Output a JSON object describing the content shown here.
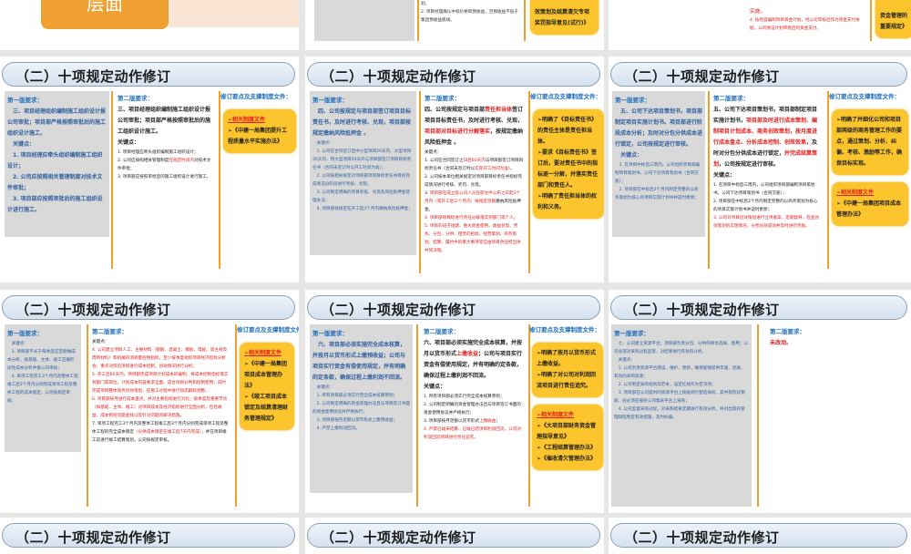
{
  "top": {
    "left_tag": "层面",
    "middle": {
      "lines": [
        "划。",
        "2. 项目经理确认中标价格和预收益，且预收益不低于集团预收益底线。"
      ],
      "box": "效策划及结算清欠专项奖罚指导意见(试行)》"
    },
    "right": {
      "lines": [
        "实施。",
        "4. 按月度编制项目资金计划，经公司审核后作为资金支付依据，公司保证计划审批后的资金支付。"
      ],
      "box": "资金管理的重要规定》"
    }
  },
  "slides": [
    {
      "title": "（二）十项规定动作修订",
      "v1": {
        "heading": "第一版要求：",
        "paras": [
          [
            "三、项目经理组织编制施工组织设计报公司审批；项目部严格按照审批后的施工组织设计施工。"
          ],
          [
            "关键点："
          ],
          [
            "1. 项目经理应牵头组织编制施工组织设计；"
          ],
          [
            "2. 公司应按照相关管理制度对技术文件审批；"
          ],
          [
            "3. 项目部应按照审批后的施工组织设计进行施工。"
          ]
        ]
      },
      "v2": {
        "heading": "第二版要求：",
        "paras": [
          {
            "segs": [
              [
                "三、项目经理组织编制施工组织设计报公司审批；项目部严格按照审批后的施工组织设计施工。",
                0
              ]
            ]
          },
          {
            "segs": [
              [
                "关键点：",
                0
              ]
            ]
          },
          {
            "small": 1,
            "segs": [
              [
                "1. 项目经理应牵头组织编制施工组织设计；",
                0
              ]
            ]
          },
          {
            "small": 1,
            "segs": [
              [
                "2. 公司应按照相关管理制度",
                0
              ],
              [
                "在规定时间内",
                1
              ],
              [
                "对技术文件审批；",
                0
              ]
            ]
          },
          {
            "small": 1,
            "segs": [
              [
                "3. 项目部应按照审批后的施工组织设计进行施工。",
                0
              ]
            ]
          }
        ]
      },
      "right": {
        "heading": "修订要点及支撑制度文件：",
        "boxes": [
          [
            "#➢相关制度文件",
            "➢《中建一局集团提升工程质量水平实施办法》"
          ]
        ]
      }
    },
    {
      "title": "（二）十项规定动作修订",
      "v1": {
        "heading": "第一版要求：",
        "paras": [
          [
            "四、公司按规定与项目部签订项目目标责任书，及时进行考核、兑现，项目部按规定缴纳风险抵押金 。"
          ],
          [
            "关键点：",
            1
          ],
          [
            "1. 公司在合同签订后中小型项目20天内、大型项目35天内、特大型项目50天内与项目部签订项目目标责任书（合同未签订时以开工时间为准）；",
            1
          ],
          [
            "2. 公司按相关规定对项目部项目目标责任书目标完成情况分阶段进行考核、兑现。",
            1
          ],
          [
            "3. 公司制定明确的项目考核、兑现及风险抵押金管理办法；",
            1
          ],
          [
            "4. 项目部按规定在开工后3个月内缴纳风险抵押金；",
            1
          ]
        ]
      },
      "v2": {
        "heading": "第二版要求：",
        "paras": [
          {
            "segs": [
              [
                "四、公司按规定与项目部",
                0
              ],
              [
                "责任担当体",
                1
              ],
              [
                "签订项目目标责任书，及时进行考核、兑现，",
                0
              ],
              [
                "项目部对目标进行分解落实",
                1
              ],
              [
                "，按规定缴纳风险抵押金 。",
                0
              ]
            ]
          },
          {
            "small": 1,
            "segs": [
              [
                "关键点：",
                0
              ]
            ]
          },
          {
            "small": 1,
            "segs": [
              [
                "1. 公司在合同签订之",
                0
              ],
              [
                "日后60天内",
                1
              ],
              [
                "与项目部签订项目目标责任书（合同未签订时以",
                0
              ],
              [
                "实际开工时间为准",
                1
              ],
              [
                "）。",
                0
              ]
            ]
          },
          {
            "small": 1,
            "segs": [
              [
                "2. 公司按本单位相关规定对项目部目标责任书指标完成情况进行考核、奖罚、兑现。",
                0
              ]
            ]
          },
          {
            "small": 1,
            "segs": [
              [
                "3. ",
                0
              ],
              [
                "项目部在成立及公司人员任职文件公布之日起2个月内（或开工后三个月内）按规定足额",
                1
              ],
              [
                "缴纳风险抵押金。",
                0
              ]
            ]
          },
          {
            "small": 1,
            "segs": [
              [
                "4. 项目部将目标进行责任分解落实到部门或个人。",
                1
              ]
            ]
          },
          {
            "small": 1,
            "segs": [
              [
                "5. 项目的班子组建、重大资金使用、收益兑现、劳务、分包、分供、租赁的招标、经营策划、商务策划、结算、履约中的重大事项等应由项目责任担当体共同决策。",
                1
              ]
            ]
          }
        ]
      },
      "right": {
        "heading": "修订要点及支撑制度文件：",
        "boxes": [
          [
            "➢明确了《目标责任书》的责任主体是责任担当体。",
            "➢要求《目标责任书》签订后，要对责任书中的指标逐一分解，并落实责任部门和责任人。",
            "➢明确了责任担当体的权利和义务。"
          ]
        ]
      }
    },
    {
      "title": "（二）十项规定动作修订",
      "v1": {
        "heading": "第一版要求：",
        "paras": [
          [
            "五、公司下达项目策划书，项目部制定项目实施计划书。项目部进行阶段成本分析；及时对分包分供成本进行锁定，公司按规定进行审核。"
          ],
          [
            "关键点："
          ],
          [
            "1. 在项目中标后三周内，公司组织项目部编制项目策划书，公司下达项目策划书（合同交底）；",
            1
          ],
          [
            "2. 项目部在中标后2个月内制定完整的以商务策划为核心的项目实施计划书并适时更新；",
            1
          ]
        ]
      },
      "v2": {
        "heading": "第二版要求：",
        "paras": [
          {
            "segs": [
              [
                "五、公司下达项目策划书，项目部制定项目实施计划书，",
                0
              ],
              [
                "项目部及时进行成本策划、编制项目计划成本、商务创效策划，按月度进行成本盘点、分析成本控制、创效效果",
                1
              ],
              [
                "，及时对分包分供成本进行锁定，",
                0
              ],
              [
                "并完成结算策划",
                1
              ],
              [
                "，公司按规定进行审核。",
                0
              ]
            ]
          },
          {
            "segs": [
              [
                "关键点：",
                0
              ]
            ]
          },
          {
            "small": 1,
            "segs": [
              [
                "1. 在项目中标后三周内，公司组织项目部编制项目策划书，公司下达项目策划书（合同交底）；",
                0
              ]
            ]
          },
          {
            "small": 1,
            "segs": [
              [
                "2. 项目部在中标后2个月内制定完整的以商务策划为核心的项目实施计划书并适时更新；",
                0
              ]
            ]
          },
          {
            "small": 1,
            "segs": [
              [
                "3. 公司对项目创效策划进行立项备案，定期督导，检查创效策划的实施情况，分析创效成效并及时进行奖励。",
                1
              ]
            ]
          }
        ]
      },
      "right": {
        "heading": "修订要点及支撑制度文件：",
        "boxes": [
          [
            "➢明确了并细化公司和项目部两级的商务管理工作的要点，通过策划、分析、纠偏、考核、激励等工作，确保目标实现。"
          ],
          [
            "#➢相关制度文件",
            "➢《中建一局集团项目成本管理办法》"
          ]
        ]
      }
    },
    {
      "title": "（二）十项规定动作修订",
      "v1": {
        "heading": "第一版要求：",
        "paras": [
          [
            "关键点：",
            1
          ],
          [
            "3. 项目部不长于每季度应定期做成本分析，按基础、主体、竣工应做阶段性成本分析并报公司审核；",
            1
          ],
          [
            "4. 单项工程完工3个月内及整体工程竣工后3个月内分别完成单项工程及整体工程的成本锁定，公司按规定审核；",
            1
          ]
        ]
      },
      "v2": {
        "heading": "第二版要求：",
        "paras": [
          {
            "small": 1,
            "segs": [
              [
                "关键点：",
                0
              ]
            ]
          },
          {
            "small": 1,
            "segs": [
              [
                "4. 公司建立项目人工、主要材料（钢筋、混凝土、模板、电缆、等主材及周转材料）和机械的消耗量控制指标，至少按季度组织项目经济指标分析会，重点对风险项目进行成本控制，创效情况进行分析。",
                1
              ]
            ]
          },
          {
            "small": 1,
            "segs": [
              [
                "5. 开工后60天内，项目部完成项目计划成本的编制，将成本控制指标落实到部门或岗位。计划成本内容要求全面，适合项目分判和控制使用；同时完成项目整体商务创效策划，在施工过程中进行动态跟踪调整。",
                1
              ]
            ]
          },
          {
            "small": 1,
            "segs": [
              [
                "6. 项目部按月进行成本盘点，并对主要指标进行对比；按季度及重要节点（如基础、主体、竣工）对项目成本及经济指标进行全面分析，包括收益、成本管控问题查找以及针对问题的解决措施。",
                1
              ]
            ]
          },
          {
            "small": 1,
            "segs": [
              [
                "7. 单项工程完工3个月内及整体工程竣工后3个月内分别完成单项工程及整体工程的完全成本锁定",
                0
              ],
              [
                "（分供成本锁定在竣工后7天内完成）",
                1
              ],
              [
                "，并在项目竣工前进行竣工结算策划，公司按规定审核。",
                0
              ]
            ]
          }
        ]
      },
      "right": {
        "heading": "修订要点及支撑制度文件：",
        "boxes": [
          [
            "#➢相关制度文件",
            "➢《中建一局集团项目成本管理办法》",
            "➢《竣工项目成本锁定及结算清理财务管理规定》"
          ]
        ]
      }
    },
    {
      "title": "（二）十项规定动作修订",
      "v1": {
        "heading": "第一版要求：",
        "paras": [
          [
            "六、项目部必须实施完全成本核算，并按月以货币形式上缴预收益；公司与项目实行资金有偿使用规定，并有明确的定条款，确保过程上缴利润不回流。"
          ],
          [
            "关键点：",
            1
          ],
          [
            "1. 所有项目部必须实行完全成本核算原则；",
            1
          ],
          [
            "2. 公司制定明确的资金管理办法且与项目签订书面的资金使用协议并严格执行；",
            1
          ],
          [
            "3. 项目部按月足额以货币形式上缴预收益；",
            1
          ],
          [
            "4. 严禁上缴利润回流。",
            1
          ]
        ]
      },
      "v2": {
        "heading": "第二版要求：",
        "paras": [
          {
            "segs": [
              [
                "六、项目部必须实施完全成本核算，并按月以货币形式",
                0
              ],
              [
                "上缴收益",
                1
              ],
              [
                "；公司与项目实行资金有偿使用规定，并有明确约定条款，确保过程上缴利润不回流。",
                0
              ]
            ]
          },
          {
            "segs": [
              [
                "关键点：",
                0
              ]
            ]
          },
          {
            "small": 1,
            "segs": [
              [
                "1. 所有项目部必须实行完全成本核算原则；",
                0
              ]
            ]
          },
          {
            "small": 1,
            "segs": [
              [
                "2. 公司制定明确的资金管理办法且与项目签订书面的资金使用协议并严格执行；",
                0
              ]
            ]
          },
          {
            "small": 1,
            "segs": [
              [
                "3. 项目部按月足额以货币形式",
                0
              ],
              [
                "上缴收益",
                1
              ],
              [
                "；",
                0
              ]
            ]
          },
          {
            "small": 1,
            "segs": [
              [
                "4. 严禁已竣未结算、已竣已结项目利润回流，公司对利润回流项目进行责任追究。",
                1
              ]
            ]
          }
        ]
      },
      "right": {
        "heading": "修订要点及支撑制度文件：",
        "boxes": [
          [
            "➢明确了按月以货币形式上缴收益。",
            "➢明确了对公司对利润回流项目进行责任追究。"
          ],
          [
            "#➢相关制度文件",
            "➢《大项目部财务资金管理指导意见》",
            "➢《工程结算管理办法》",
            "➢《催收清欠管理办法》"
          ]
        ]
      }
    },
    {
      "title": "（二）十项规定动作修订",
      "v1": {
        "heading": "第一版要求：",
        "paras": [
          [
            "七、公司建立资源平台；项目部负责分包、分供的择优选择、使用；公司总部对采购过程监管，对结果进行有效的分析。",
            1
          ],
          [
            "关键点：",
            1
          ],
          [
            "1. 公司负责资源平台建设、维护、更新，确保能够提供丰富、优质、有效的采购资源；",
            1
          ],
          [
            "2. 公司制定采购规则及范本，设定红线作为否决项；",
            1
          ],
          [
            "3. 项目部在公司提供的资源平台上按规则行使选择权，其中现阶段钢筋、砼必须在股份公司集采平台上采购；",
            1
          ],
          [
            "4. 公司监督采购过程，对采购结果定期进行有效分析，并对出现的管理缺陷制定有效措施，及时纠偏。",
            1
          ]
        ]
      },
      "v2": {
        "heading": "第二版要求：",
        "paras": [
          {
            "segs": [
              [
                "未改动。",
                1
              ]
            ]
          }
        ]
      },
      "right": null
    },
    {
      "title": "（二）十项规定动作修订"
    },
    {
      "title": "（二）十项规定动作修订"
    },
    {
      "title": "（二）十项规定动作修订"
    }
  ]
}
